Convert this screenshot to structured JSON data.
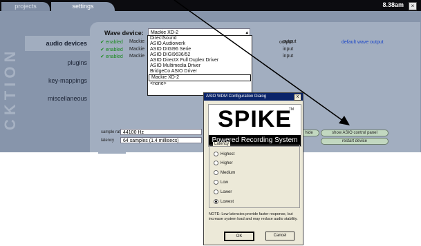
{
  "tabs": [
    {
      "label": "projects"
    },
    {
      "label": "settings"
    }
  ],
  "clock": "8.38am",
  "brand": "CKTION",
  "nav": {
    "items": [
      {
        "label": "audio devices"
      },
      {
        "label": "plugins"
      },
      {
        "label": "key-mappings"
      },
      {
        "label": "miscellaneous"
      }
    ]
  },
  "wave": {
    "label": "Wave device:",
    "selected": "Mackie XD-2",
    "headers": {
      "output": "output",
      "default": "default wave output"
    },
    "rows": [
      {
        "enabled": "enabled",
        "name": "Mackie",
        "io": "output"
      },
      {
        "enabled": "enabled",
        "name": "Mackie",
        "io": "input"
      },
      {
        "enabled": "enabled",
        "name": "Mackie",
        "io": "input"
      }
    ],
    "options": [
      "DirectSound",
      "ASIO Audiowerk",
      "ASIO DIGI96 Serie",
      "ASIO DIGI9636/52",
      "ASIO DirectX Full Duplex Driver",
      "ASIO Multimedia Driver",
      "BridgeCo ASIO Driver",
      "Mackie XD-2",
      "<none>"
    ]
  },
  "fields": {
    "samplerate_label": "sample rate",
    "samplerate_value": "44100 Hz",
    "latency_label": "latency",
    "latency_value": "64 samples (1.4 millisecs)"
  },
  "buttons": {
    "hide": "hide",
    "asio_panel": "show ASIO control panel",
    "restart": "restart device"
  },
  "dialog": {
    "title": "ASIO WDM Configuration Dialog",
    "close": "x",
    "logo_word": "SPIKE",
    "logo_tm": "TM",
    "logo_sub": "Powered Recording System",
    "latency_group": "Latency",
    "options": [
      "Highest",
      "Higher",
      "Medium",
      "Low",
      "Lower",
      "Lowest"
    ],
    "selected": "Lowest",
    "note": "NOTE: Low latencies provide faster response, but increase system load and may reduce audio stability.",
    "ok": "OK",
    "cancel": "Cancel"
  }
}
